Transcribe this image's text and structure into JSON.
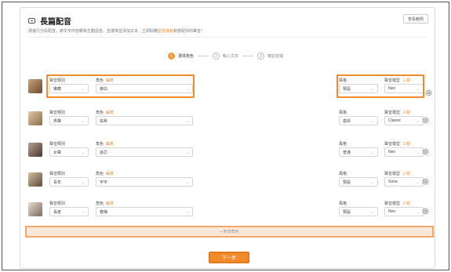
{
  "header": {
    "title": "長篇配音",
    "subtitle_pre": "請進行分段配音，將文字內容轉為生動語音，並選擇並添加文本，立即聆聽",
    "subtitle_link": "語音樣貌",
    "subtitle_post": "和搭配你的聲音！",
    "sample_button": "查看範例"
  },
  "steps": [
    {
      "num": "1",
      "label": "選擇角色",
      "active": true
    },
    {
      "num": "2",
      "label": "輸入文本",
      "active": false
    },
    {
      "num": "3",
      "label": "確認音檔",
      "active": false
    }
  ],
  "labels": {
    "voice_type": "聲音類別",
    "role": "角色",
    "role_link": "編寫",
    "style": "風格",
    "voice_model": "聲音模型",
    "model_link": "三視"
  },
  "rows": [
    {
      "voice_type": "推薦",
      "role": "旁白",
      "style": "預設",
      "model": "Neo"
    },
    {
      "voice_type": "男聲",
      "role": "佑希",
      "style": "激昂",
      "model": "Classic"
    },
    {
      "voice_type": "女聲",
      "role": "詠芯",
      "style": "普通",
      "model": "Neo"
    },
    {
      "voice_type": "青年",
      "role": "宇宇",
      "style": "預設",
      "model": "Sona"
    },
    {
      "voice_type": "長者",
      "role": "春梅",
      "style": "預設",
      "model": "Neo"
    }
  ],
  "add_role": "+ 新增角色",
  "next_button": "下一步",
  "colors": {
    "accent": "#f08a2a",
    "highlight": "#f08c2e"
  },
  "icons": {
    "gear": "gear-icon",
    "chevron": "chevron-down-icon",
    "voice": "voice-icon"
  }
}
